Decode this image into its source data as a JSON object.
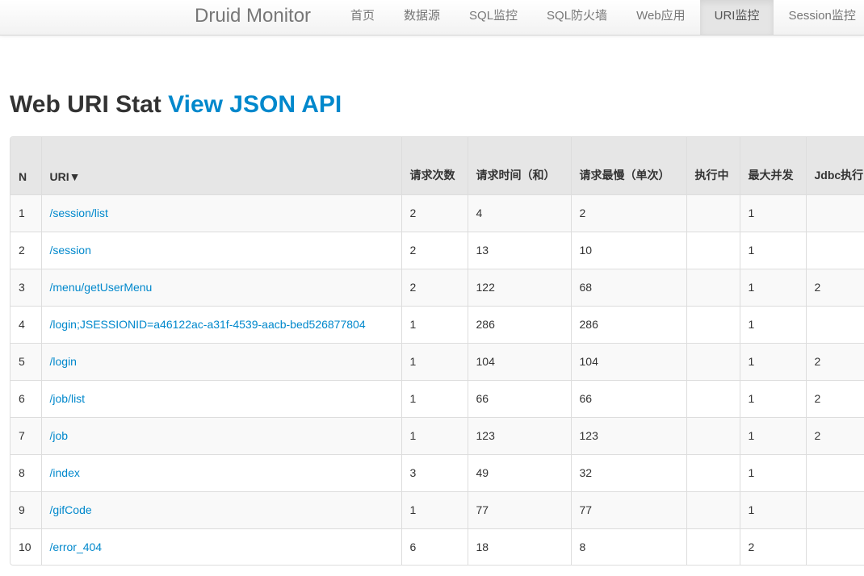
{
  "navbar": {
    "brand": "Druid Monitor",
    "items": [
      {
        "label": "首页",
        "active": false
      },
      {
        "label": "数据源",
        "active": false
      },
      {
        "label": "SQL监控",
        "active": false
      },
      {
        "label": "SQL防火墙",
        "active": false
      },
      {
        "label": "Web应用",
        "active": false
      },
      {
        "label": "URI监控",
        "active": true
      },
      {
        "label": "Session监控",
        "active": false
      }
    ]
  },
  "page": {
    "title": "Web URI Stat",
    "api_link": "View JSON API"
  },
  "table": {
    "columns": [
      "N",
      "URI▼",
      "请求次数",
      "请求时间（和）",
      "请求最慢（单次）",
      "执行中",
      "最大并发",
      "Jdbc执行"
    ],
    "rows": [
      {
        "n": "1",
        "uri": "/session/list",
        "count": "2",
        "time": "4",
        "slowest": "2",
        "running": "",
        "max_concurrent": "1",
        "jdbc": ""
      },
      {
        "n": "2",
        "uri": "/session",
        "count": "2",
        "time": "13",
        "slowest": "10",
        "running": "",
        "max_concurrent": "1",
        "jdbc": ""
      },
      {
        "n": "3",
        "uri": "/menu/getUserMenu",
        "count": "2",
        "time": "122",
        "slowest": "68",
        "running": "",
        "max_concurrent": "1",
        "jdbc": "2"
      },
      {
        "n": "4",
        "uri": "/login;JSESSIONID=a46122ac-a31f-4539-aacb-bed526877804",
        "count": "1",
        "time": "286",
        "slowest": "286",
        "running": "",
        "max_concurrent": "1",
        "jdbc": ""
      },
      {
        "n": "5",
        "uri": "/login",
        "count": "1",
        "time": "104",
        "slowest": "104",
        "running": "",
        "max_concurrent": "1",
        "jdbc": "2"
      },
      {
        "n": "6",
        "uri": "/job/list",
        "count": "1",
        "time": "66",
        "slowest": "66",
        "running": "",
        "max_concurrent": "1",
        "jdbc": "2"
      },
      {
        "n": "7",
        "uri": "/job",
        "count": "1",
        "time": "123",
        "slowest": "123",
        "running": "",
        "max_concurrent": "1",
        "jdbc": "2"
      },
      {
        "n": "8",
        "uri": "/index",
        "count": "3",
        "time": "49",
        "slowest": "32",
        "running": "",
        "max_concurrent": "1",
        "jdbc": ""
      },
      {
        "n": "9",
        "uri": "/gifCode",
        "count": "1",
        "time": "77",
        "slowest": "77",
        "running": "",
        "max_concurrent": "1",
        "jdbc": ""
      },
      {
        "n": "10",
        "uri": "/error_404",
        "count": "6",
        "time": "18",
        "slowest": "8",
        "running": "",
        "max_concurrent": "2",
        "jdbc": ""
      }
    ]
  },
  "colors": {
    "link": "#0088cc",
    "header_bg": "#e6e6e6",
    "nav_active_bg": "#e5e5e5"
  }
}
